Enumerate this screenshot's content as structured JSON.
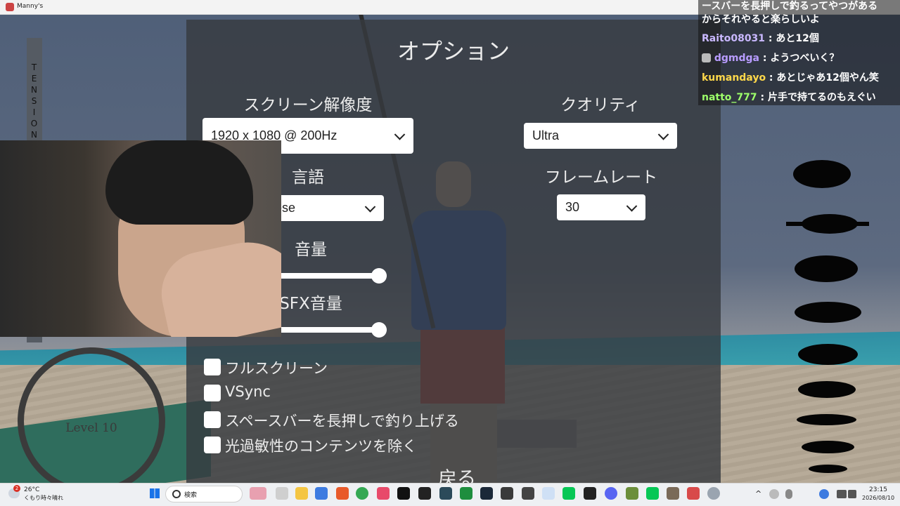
{
  "window": {
    "title": "Manny's"
  },
  "game": {
    "tension_label": "TENSION",
    "level_label": "Level 10"
  },
  "options": {
    "title": "オプション",
    "resolution": {
      "label": "スクリーン解像度",
      "value": "1920 x 1080 @ 200Hz"
    },
    "quality": {
      "label": "クオリティ",
      "value": "Ultra"
    },
    "language": {
      "label": "言語",
      "value": "Japanese"
    },
    "framerate": {
      "label": "フレームレート",
      "value": "30"
    },
    "volume": {
      "label": "音量",
      "level": 1.0
    },
    "sfx_volume": {
      "label": "SFX音量",
      "level": 1.0
    },
    "checkboxes": [
      {
        "label": "フルスクリーン",
        "checked": false
      },
      {
        "label": "VSync",
        "checked": false
      },
      {
        "label": "スペースバーを長押しで釣り上げる",
        "checked": false
      },
      {
        "label": "光過敏性のコンテンツを除く",
        "checked": false
      }
    ],
    "back_label": "戻る"
  },
  "chat": {
    "lines": [
      {
        "user": "",
        "text": "ースバーを長押しで釣るってやつがある"
      },
      {
        "user": "",
        "text": "からそれやると楽らしいよ"
      },
      {
        "user": "Raito08031",
        "text": "あと12個",
        "color": "#c9b8ff"
      },
      {
        "user": "dgmdga",
        "text": "ようつべいく？",
        "color": "#b89cff"
      },
      {
        "user": "kumandayo",
        "text": "あとじゃあ12個やん笑",
        "color": "#ffd84a"
      },
      {
        "user": "natto_777",
        "text": "片手で持てるのもえぐい",
        "color": "#9dff6a"
      }
    ]
  },
  "taskbar": {
    "weather_temp": "26°C",
    "weather_desc": "くもり時々晴れ",
    "weather_badge": "2",
    "search_placeholder": "検索",
    "time": "23:15",
    "date": "2026/08/10"
  },
  "colors": {
    "panel": "#373a40",
    "chat_bg": "#141414",
    "taskbar": "#eef0f3"
  }
}
